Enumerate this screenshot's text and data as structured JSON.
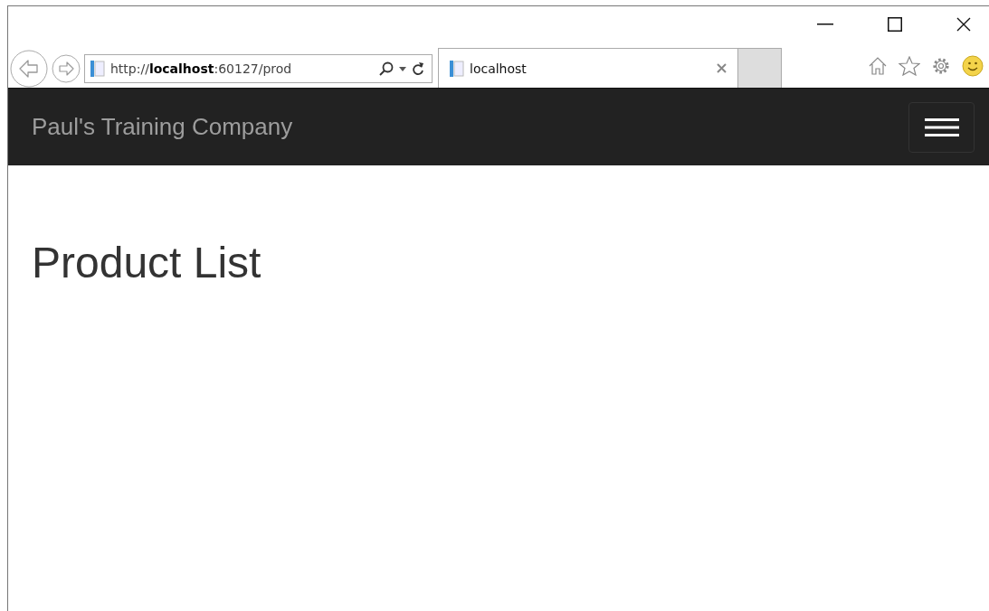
{
  "address_bar": {
    "url": "http://**localhost**:60127/prod"
  },
  "tabs": [
    {
      "label": "localhost",
      "selected": true
    }
  ],
  "navbar": {
    "brand": "Paul's Training Company"
  },
  "page": {
    "heading": "Product List"
  }
}
